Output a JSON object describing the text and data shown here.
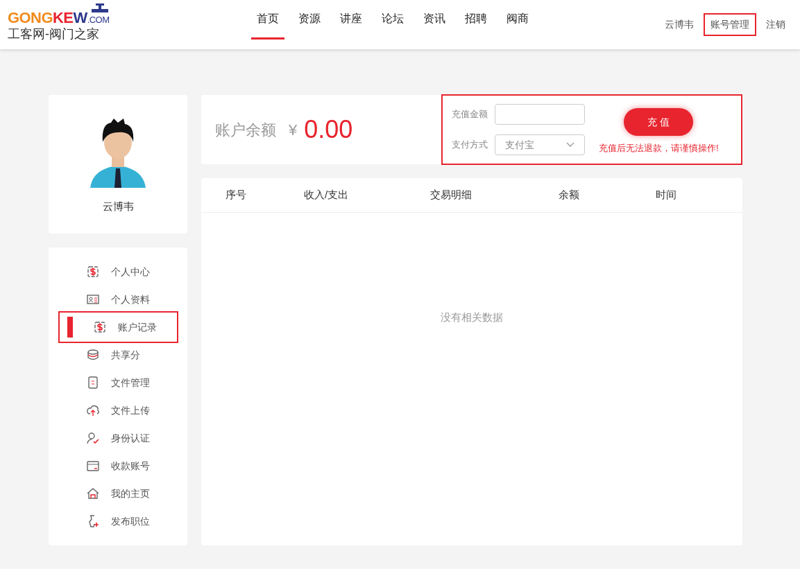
{
  "logo": {
    "parts": [
      "GONG",
      "KE",
      "W",
      ".COM"
    ],
    "subtitle": "工客网-阀门之家"
  },
  "nav": [
    {
      "label": "首页",
      "selected": true
    },
    {
      "label": "资源",
      "selected": false
    },
    {
      "label": "讲座",
      "selected": false
    },
    {
      "label": "论坛",
      "selected": false
    },
    {
      "label": "资讯",
      "selected": false
    },
    {
      "label": "招聘",
      "selected": false
    },
    {
      "label": "阀商",
      "selected": false
    }
  ],
  "user_links": [
    {
      "label": "云博韦",
      "highlighted": false
    },
    {
      "label": "账号管理",
      "highlighted": true
    },
    {
      "label": "注销",
      "highlighted": false
    }
  ],
  "profile": {
    "name": "云博韦"
  },
  "menu": [
    {
      "label": "个人中心",
      "kind": "money",
      "selected": false
    },
    {
      "label": "个人资料",
      "kind": "card",
      "selected": false
    },
    {
      "label": "账户记录",
      "kind": "money",
      "selected": true
    },
    {
      "label": "共享分",
      "kind": "coins",
      "selected": false
    },
    {
      "label": "文件管理",
      "kind": "file",
      "selected": false
    },
    {
      "label": "文件上传",
      "kind": "upload",
      "selected": false
    },
    {
      "label": "身份认证",
      "kind": "verify",
      "selected": false
    },
    {
      "label": "收款账号",
      "kind": "wallet",
      "selected": false
    },
    {
      "label": "我的主页",
      "kind": "home",
      "selected": false
    },
    {
      "label": "发布职位",
      "kind": "job",
      "selected": false
    }
  ],
  "balance": {
    "label": "账户余额",
    "currency": "¥",
    "amount": "0.00"
  },
  "recharge": {
    "highlighted": true,
    "amount_label": "充值金额",
    "method_label": "支付方式",
    "method_value": "支付宝",
    "button": "充 值",
    "warning": "充值后无法退款，请谨慎操作!"
  },
  "table": {
    "columns": [
      "序号",
      "收入/支出",
      "交易明细",
      "余额",
      "时间"
    ],
    "empty_text": "没有相关数据"
  }
}
